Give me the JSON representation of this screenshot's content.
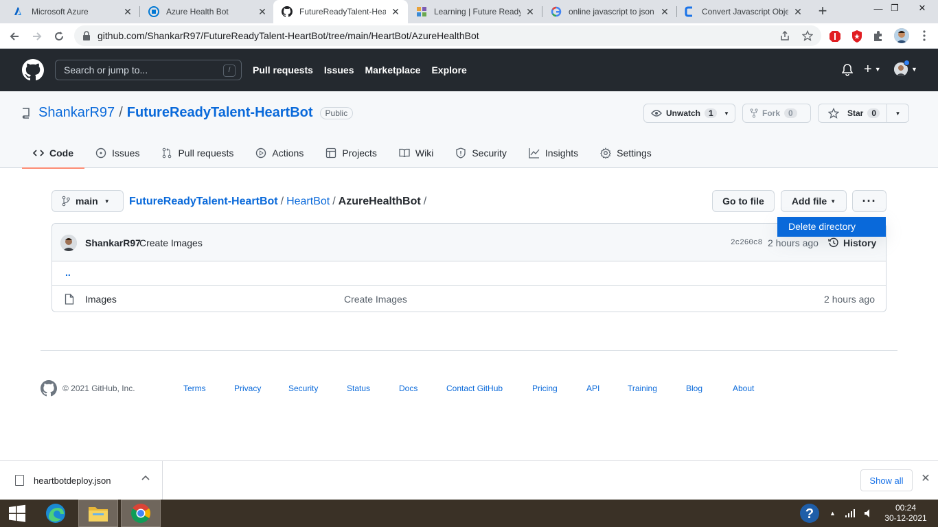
{
  "browser": {
    "tabs": [
      {
        "title": "Microsoft Azure",
        "active": false
      },
      {
        "title": "Azure Health Bot",
        "active": false
      },
      {
        "title": "FutureReadyTalent-HeartBot/HeartBot/AzureHealthBot",
        "active": true
      },
      {
        "title": "Learning | Future Ready Talent",
        "active": false
      },
      {
        "title": "online javascript to json",
        "active": false
      },
      {
        "title": "Convert Javascript Object",
        "active": false
      }
    ],
    "url": "github.com/ShankarR97/FutureReadyTalent-HeartBot/tree/main/HeartBot/AzureHealthBot"
  },
  "github": {
    "search_placeholder": "Search or jump to...",
    "search_hotkey": "/",
    "nav": [
      "Pull requests",
      "Issues",
      "Marketplace",
      "Explore"
    ],
    "plus": "+"
  },
  "repo": {
    "owner": "ShankarR97",
    "separator": "/",
    "name": "FutureReadyTalent-HeartBot",
    "visibility": "Public",
    "watch_label": "Unwatch",
    "watch_count": "1",
    "fork_label": "Fork",
    "fork_count": "0",
    "star_label": "Star",
    "star_count": "0",
    "tabs": [
      "Code",
      "Issues",
      "Pull requests",
      "Actions",
      "Projects",
      "Wiki",
      "Security",
      "Insights",
      "Settings"
    ]
  },
  "content": {
    "branch": "main",
    "crumbs": [
      "FutureReadyTalent-HeartBot",
      "HeartBot",
      "AzureHealthBot"
    ],
    "crumb_sep": "/",
    "go_to_file": "Go to file",
    "add_file": "Add file",
    "more": "···",
    "dropdown_item": "Delete directory",
    "commit": {
      "author": "ShankarR97",
      "message": "Create Images",
      "sha": "2c260c8",
      "time": "2 hours ago",
      "history": "History"
    },
    "parent": "..",
    "files": [
      {
        "name": "Images",
        "message": "Create Images",
        "age": "2 hours ago"
      }
    ]
  },
  "footer": {
    "copyright": "© 2021 GitHub, Inc.",
    "links": [
      "Terms",
      "Privacy",
      "Security",
      "Status",
      "Docs",
      "Contact GitHub",
      "Pricing",
      "API",
      "Training",
      "Blog",
      "About"
    ]
  },
  "downloads": {
    "file": "heartbotdeploy.json",
    "show_all": "Show all"
  },
  "taskbar": {
    "time": "00:24",
    "date": "30-12-2021"
  },
  "colors": {
    "github_header": "#24292f",
    "link": "#0969da",
    "selected_tab_underline": "#fd8c73",
    "dropdown_highlight": "#0969da"
  }
}
